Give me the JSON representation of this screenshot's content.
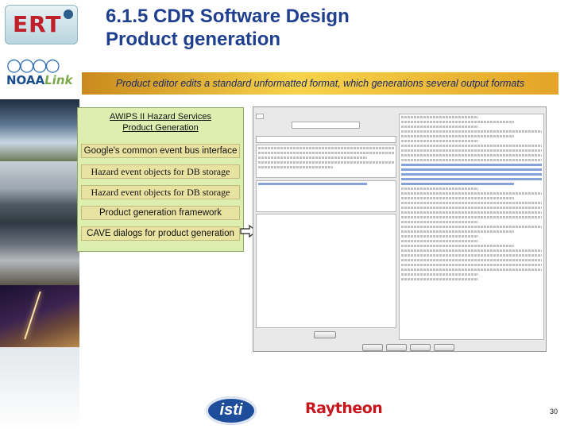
{
  "slide": {
    "title_line1": "6.1.5 CDR Software Design",
    "title_line2": "Product generation",
    "banner": "Product editor edits a standard unformatted format, which generations several output formats",
    "page_number": "30"
  },
  "logos": {
    "ert": "ERT",
    "noaa_left": "NOAA",
    "noaa_right": "Link",
    "isti": "isti",
    "raytheon": "Raytheon"
  },
  "panel": {
    "title_line1": "AWIPS II Hazard Services",
    "title_line2": "Product Generation",
    "rows": [
      "Google's common event bus interface",
      "Hazard event objects for DB storage",
      "Hazard event objects for DB storage",
      "Product generation framework",
      "CAVE dialogs for product generation"
    ]
  },
  "colors": {
    "title": "#1f3f8f",
    "banner_start": "#c98a1d",
    "banner_mid": "#f7d34a",
    "panel_bg": "#dcefb0",
    "row_bg": "#e9e3a2",
    "raytheon": "#c8161d",
    "isti": "#1e4d9b"
  }
}
